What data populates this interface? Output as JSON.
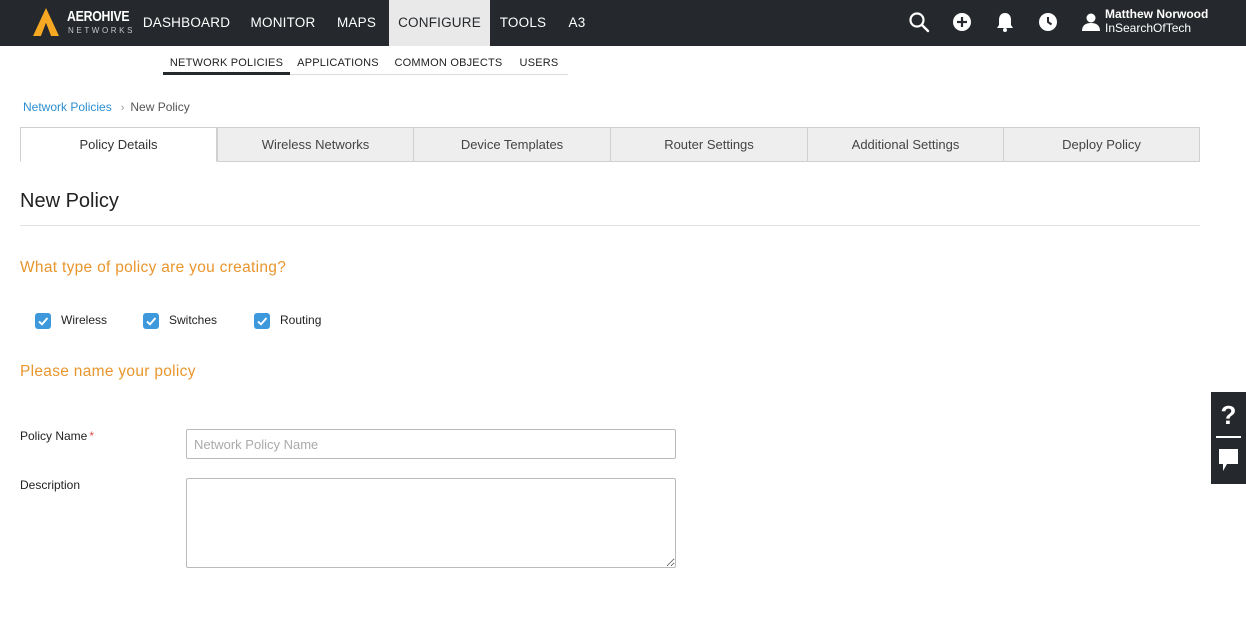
{
  "brand": {
    "name": "AEROHIVE",
    "sub": "NETWORKS",
    "accent": "#f7a823"
  },
  "topnav": {
    "items": [
      {
        "label": "DASHBOARD"
      },
      {
        "label": "MONITOR"
      },
      {
        "label": "MAPS"
      },
      {
        "label": "CONFIGURE"
      },
      {
        "label": "TOOLS"
      },
      {
        "label": "A3"
      }
    ],
    "active": "CONFIGURE",
    "icons": [
      "search-icon",
      "add-icon",
      "bell-icon",
      "clock-icon",
      "user-icon"
    ],
    "user": {
      "name": "Matthew Norwood",
      "org": "InSearchOfTech"
    }
  },
  "subnav": {
    "items": [
      {
        "label": "NETWORK POLICIES"
      },
      {
        "label": "APPLICATIONS"
      },
      {
        "label": "COMMON OBJECTS"
      },
      {
        "label": "USERS"
      }
    ],
    "active": "NETWORK POLICIES"
  },
  "breadcrumb": {
    "parent": "Network Policies",
    "current": "New Policy"
  },
  "tabs": [
    {
      "label": "Policy Details"
    },
    {
      "label": "Wireless Networks"
    },
    {
      "label": "Device Templates"
    },
    {
      "label": "Router Settings"
    },
    {
      "label": "Additional Settings"
    },
    {
      "label": "Deploy Policy"
    }
  ],
  "active_tab": "Policy Details",
  "page": {
    "title": "New Policy",
    "type_heading": "What type of policy are you creating?",
    "options": [
      {
        "label": "Wireless",
        "checked": true
      },
      {
        "label": "Switches",
        "checked": true
      },
      {
        "label": "Routing",
        "checked": true
      }
    ],
    "name_heading": "Please name your policy",
    "fields": {
      "policy_name_label": "Policy Name",
      "required_marker": "*",
      "policy_name_placeholder": "Network Policy Name",
      "policy_name_value": "",
      "description_label": "Description",
      "description_value": ""
    }
  },
  "side_widget": {
    "help_icon": "question-icon",
    "chat_icon": "chat-icon"
  },
  "colors": {
    "heading": "#e8962d",
    "link": "#2d8fd1",
    "checkbox": "#3d98dc",
    "topbar": "#25282c"
  }
}
